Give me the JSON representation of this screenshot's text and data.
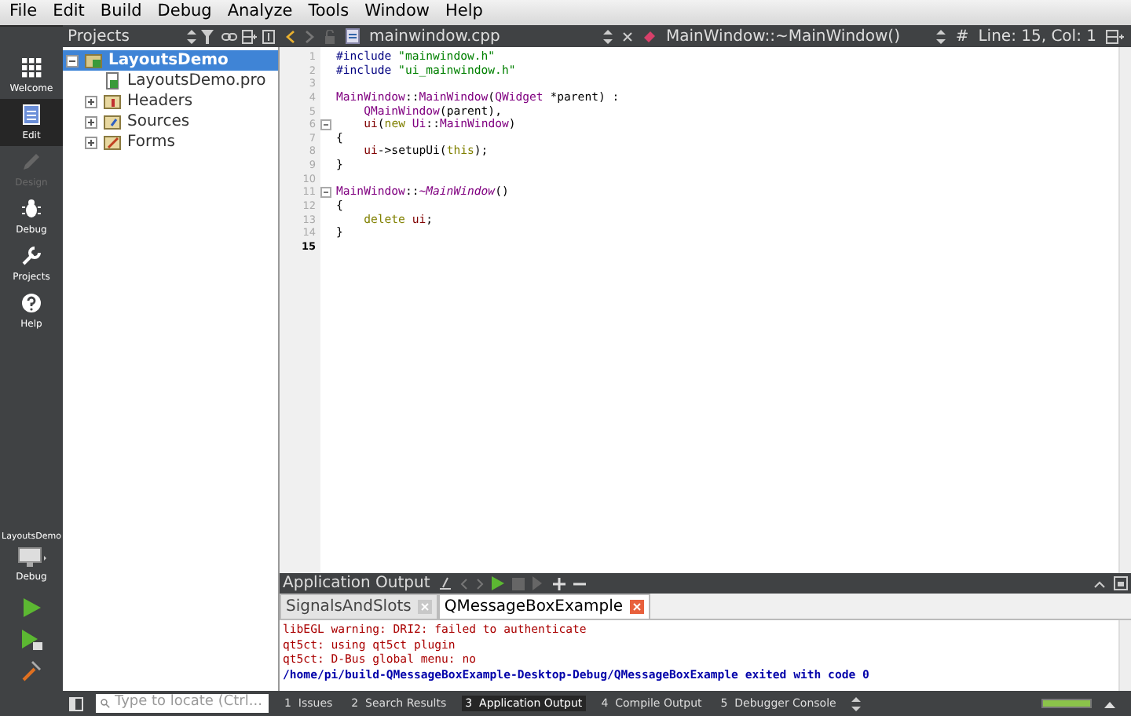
{
  "menu_bar": [
    "File",
    "Edit",
    "Build",
    "Debug",
    "Analyze",
    "Tools",
    "Window",
    "Help"
  ],
  "modes": [
    {
      "label": "Welcome",
      "selected": false,
      "disabled": false
    },
    {
      "label": "Edit",
      "selected": true,
      "disabled": false
    },
    {
      "label": "Design",
      "selected": false,
      "disabled": true
    },
    {
      "label": "Debug",
      "selected": false,
      "disabled": false
    },
    {
      "label": "Projects",
      "selected": false,
      "disabled": false
    },
    {
      "label": "Help",
      "selected": false,
      "disabled": false
    }
  ],
  "kit": {
    "project": "LayoutsDemo",
    "config": "Debug"
  },
  "projects_panel": {
    "title": "Projects",
    "tree": [
      {
        "label": "LayoutsDemo",
        "expanded": true,
        "selected": true,
        "children": [
          {
            "label": "LayoutsDemo.pro",
            "selected": false
          },
          {
            "label": "Headers",
            "expanded": false,
            "selected": false
          },
          {
            "label": "Sources",
            "expanded": false,
            "selected": false
          },
          {
            "label": "Forms",
            "expanded": false,
            "selected": false
          }
        ]
      }
    ]
  },
  "editor": {
    "file": "mainwindow.cpp",
    "symbol": "MainWindow::~MainWindow()",
    "hash": "#",
    "position": "Line: 15, Col: 1",
    "lines": [
      {
        "n": "1",
        "fold": false,
        "indented": false,
        "tokens": [
          {
            "kind": "pre",
            "t": "#include "
          },
          {
            "kind": "str",
            "t": "\"mainwindow.h\""
          }
        ]
      },
      {
        "n": "2",
        "fold": false,
        "indented": false,
        "tokens": [
          {
            "kind": "pre",
            "t": "#include "
          },
          {
            "kind": "str",
            "t": "\"ui_mainwindow.h\""
          }
        ]
      },
      {
        "n": "3",
        "fold": false
      },
      {
        "n": "4",
        "fold": false,
        "indented": false,
        "tokens": [
          {
            "kind": "type",
            "t": "MainWindow"
          },
          {
            "kind": "plain",
            "t": "::"
          },
          {
            "kind": "type",
            "t": "MainWindow"
          },
          {
            "kind": "plain",
            "t": "("
          },
          {
            "kind": "type",
            "t": "QWidget"
          },
          {
            "kind": "plain",
            "t": " *parent) :"
          }
        ]
      },
      {
        "n": "5",
        "fold": false,
        "indented": true,
        "tokens": [
          {
            "kind": "type",
            "t": "QMainWindow"
          },
          {
            "kind": "plain",
            "t": "(parent),"
          }
        ]
      },
      {
        "n": "6",
        "fold": true,
        "indented": true,
        "tokens": [
          {
            "kind": "member",
            "t": "ui"
          },
          {
            "kind": "plain",
            "t": "("
          },
          {
            "kind": "kw",
            "t": "new "
          },
          {
            "kind": "type",
            "t": "Ui"
          },
          {
            "kind": "plain",
            "t": "::"
          },
          {
            "kind": "type",
            "t": "MainWindow"
          },
          {
            "kind": "plain",
            "t": ")"
          }
        ]
      },
      {
        "n": "7",
        "fold": false,
        "indented": false,
        "tokens": [
          {
            "kind": "plain",
            "t": "{"
          }
        ]
      },
      {
        "n": "8",
        "fold": false,
        "indented": true,
        "tokens": [
          {
            "kind": "member",
            "t": "ui"
          },
          {
            "kind": "plain",
            "t": "->setupUi("
          },
          {
            "kind": "kw",
            "t": "this"
          },
          {
            "kind": "plain",
            "t": ");"
          }
        ]
      },
      {
        "n": "9",
        "fold": false,
        "indented": false,
        "tokens": [
          {
            "kind": "plain",
            "t": "}"
          }
        ]
      },
      {
        "n": "10",
        "fold": false
      },
      {
        "n": "11",
        "fold": true,
        "indented": false,
        "tokens": [
          {
            "kind": "type",
            "t": "MainWindow"
          },
          {
            "kind": "plain",
            "t": "::"
          },
          {
            "kind": "italic",
            "t": "~MainWindow"
          },
          {
            "kind": "plain",
            "t": "()"
          }
        ]
      },
      {
        "n": "12",
        "fold": false,
        "indented": false,
        "tokens": [
          {
            "kind": "plain",
            "t": "{"
          }
        ]
      },
      {
        "n": "13",
        "fold": false,
        "indented": true,
        "tokens": [
          {
            "kind": "kw",
            "t": "delete "
          },
          {
            "kind": "member",
            "t": "ui"
          },
          {
            "kind": "plain",
            "t": ";"
          }
        ]
      },
      {
        "n": "14",
        "fold": false,
        "indented": false,
        "tokens": [
          {
            "kind": "plain",
            "t": "}"
          }
        ]
      },
      {
        "n": "15",
        "fold": false
      }
    ]
  },
  "output_pane": {
    "title": "Application Output",
    "tabs": [
      {
        "label": "SignalsAndSlots",
        "selected": false
      },
      {
        "label": "QMessageBoxExample",
        "selected": true
      }
    ],
    "lines": [
      {
        "kind": "error",
        "text": "libEGL warning: DRI2: failed to authenticate"
      },
      {
        "kind": "error",
        "text": "qt5ct: using qt5ct plugin"
      },
      {
        "kind": "error",
        "text": "qt5ct: D-Bus global menu: no"
      },
      {
        "kind": "info",
        "text": "/home/pi/build-QMessageBoxExample-Desktop-Debug/QMessageBoxExample exited with code 0"
      }
    ]
  },
  "status_bar": {
    "locate_placeholder": "Type to locate (Ctrl...",
    "panes": [
      {
        "label": "1  Issues",
        "selected": false
      },
      {
        "label": "2  Search Results",
        "selected": false
      },
      {
        "label": "3  Application Output",
        "selected": true
      },
      {
        "label": "4  Compile Output",
        "selected": false
      },
      {
        "label": "5  Debugger Console",
        "selected": false
      }
    ],
    "progress": {
      "level": 1
    }
  }
}
